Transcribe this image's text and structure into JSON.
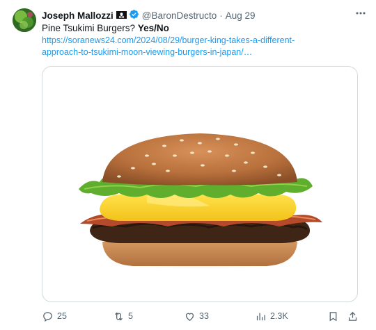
{
  "author": {
    "name": "Joseph Mallozzi",
    "handle": "@BaronDestructo",
    "date": "Aug 29"
  },
  "tweet": {
    "text_plain": "Pine Tsukimi Burgers?",
    "text_bold": "Yes/No",
    "link_line1": "https://soranews24.com/2024/08/29/burger-king-takes-a-different-",
    "link_line2": "approach-to-tsukimi-moon-viewing-burgers-in-japan/…"
  },
  "media": {
    "icon": "burger-photo"
  },
  "actions": {
    "replies": "25",
    "retweets": "5",
    "likes": "33",
    "views": "2.3K"
  },
  "icons": {
    "more": "more-icon",
    "reply": "reply-icon",
    "retweet": "retweet-icon",
    "like": "heart-icon",
    "views": "views-icon",
    "bookmark": "bookmark-icon",
    "share": "share-icon"
  },
  "colors": {
    "accent": "#1d9bf0",
    "text": "#0f1419",
    "muted": "#536471"
  }
}
